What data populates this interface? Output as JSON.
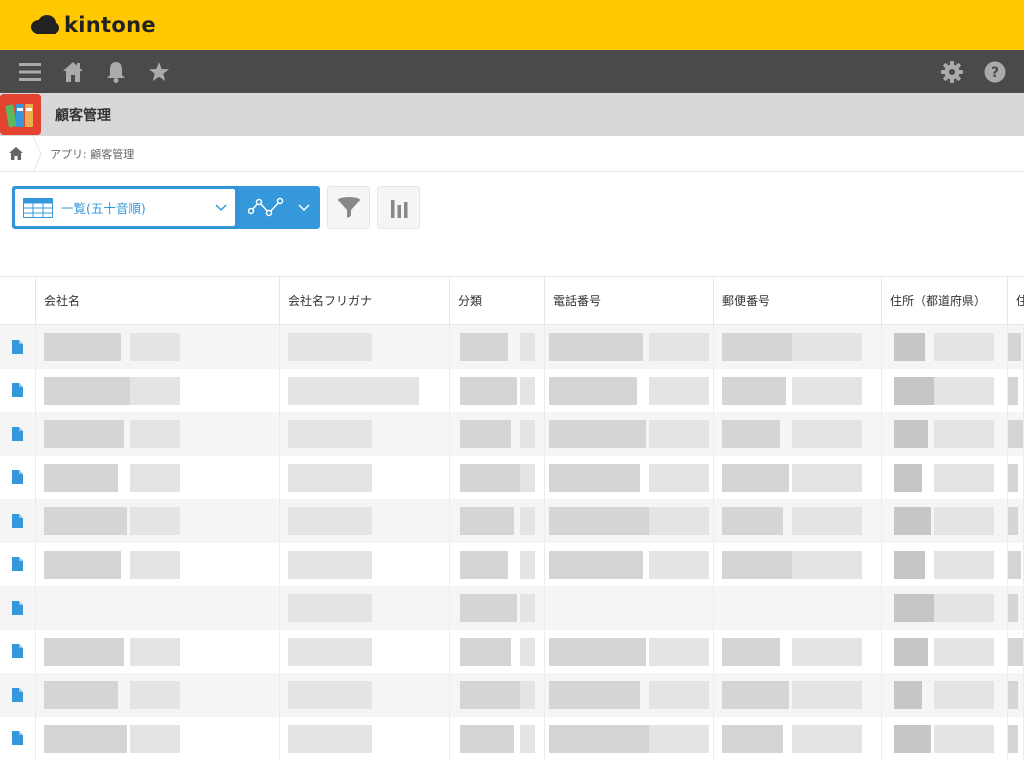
{
  "brand": {
    "name": "kintone",
    "accent": "#ffc800",
    "blue": "#3498db"
  },
  "nav": {
    "left_icons": [
      "menu-icon",
      "home-icon",
      "bell-icon",
      "star-icon"
    ],
    "right_icons": [
      "gear-icon",
      "help-icon"
    ]
  },
  "app": {
    "title": "顧客管理"
  },
  "breadcrumb": {
    "path": "アプリ: 顧客管理"
  },
  "toolbar": {
    "view_label": "一覧(五十音順)"
  },
  "table": {
    "columns": [
      "会社名",
      "会社名フリガナ",
      "分類",
      "電話番号",
      "郵便番号",
      "住所（都道府県）",
      "住"
    ],
    "row_count": 10
  }
}
